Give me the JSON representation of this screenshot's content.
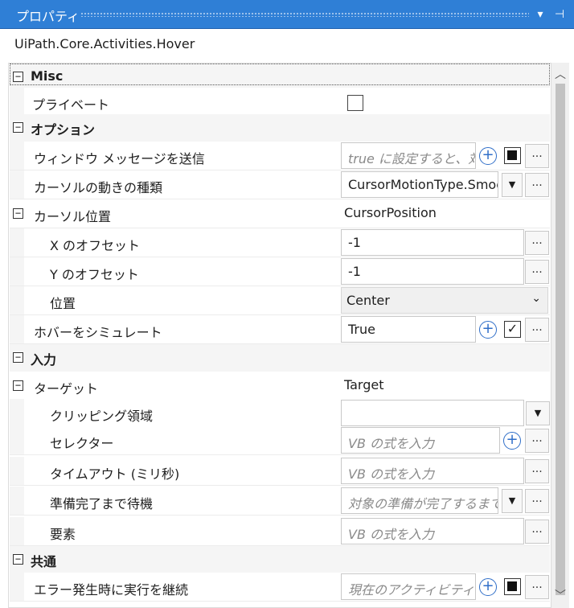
{
  "panel": {
    "title": "プロパティ",
    "dropdown_icon": "chevron-down-icon",
    "pin_icon": "pin-icon"
  },
  "object_title": "UiPath.Core.Activities.Hover",
  "categories": {
    "misc": "Misc",
    "options": "オプション",
    "input": "入力",
    "common": "共通"
  },
  "rows": {
    "private": {
      "label": "プライベート"
    },
    "send_window_msg": {
      "label": "ウィンドウ メッセージを送信",
      "value": "true に設定すると、対"
    },
    "cursor_motion": {
      "label": "カーソルの動きの種類",
      "value": "CursorMotionType.Smooth"
    },
    "cursor_position": {
      "label": "カーソル位置",
      "value": "CursorPosition"
    },
    "x_offset": {
      "label": "X のオフセット",
      "value": "-1"
    },
    "y_offset": {
      "label": "Y のオフセット",
      "value": "-1"
    },
    "position": {
      "label": "位置",
      "value": "Center"
    },
    "simulate_hover": {
      "label": "ホバーをシミュレート",
      "value": "True"
    },
    "target": {
      "label": "ターゲット",
      "value": "Target"
    },
    "clipping_region": {
      "label": "クリッピング領域",
      "value": ""
    },
    "selector": {
      "label": "セレクター",
      "value": "VB の式を入力"
    },
    "timeout": {
      "label": "タイムアウト (ミリ秒)",
      "value": "VB の式を入力"
    },
    "wait_for_ready": {
      "label": "準備完了まで待機",
      "value": "対象の準備が完了するまで"
    },
    "element": {
      "label": "要素",
      "value": "VB の式を入力"
    },
    "continue_on_error": {
      "label": "エラー発生時に実行を継続",
      "value": "現在のアクティビティが"
    }
  },
  "controls": {
    "ellipsis": "...",
    "add": "+",
    "collapse": "−",
    "checkmark": "✓",
    "dropdown_arrow": "▼",
    "select_chevron": "⌄",
    "scroll_up": "︿",
    "scroll_down": "﹀"
  }
}
